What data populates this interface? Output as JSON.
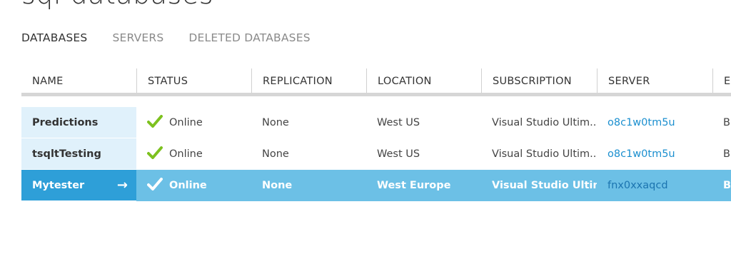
{
  "page": {
    "title": "sql databases"
  },
  "tabs": [
    {
      "label": "DATABASES"
    },
    {
      "label": "SERVERS"
    },
    {
      "label": "DELETED DATABASES"
    }
  ],
  "columns": [
    "NAME",
    "STATUS",
    "REPLICATION",
    "LOCATION",
    "SUBSCRIPTION",
    "SERVER",
    "EDITION"
  ],
  "rows": [
    {
      "name": "Predictions",
      "status": "Online",
      "replication": "None",
      "location": "West US",
      "subscription": "Visual Studio Ultim...",
      "server": "o8c1w0tm5u",
      "edition": "Basic"
    },
    {
      "name": "tsqltTesting",
      "status": "Online",
      "replication": "None",
      "location": "West US",
      "subscription": "Visual Studio Ultim...",
      "server": "o8c1w0tm5u",
      "edition": "Basic"
    },
    {
      "name": "Mytester",
      "status": "Online",
      "replication": "None",
      "location": "West Europe",
      "subscription": "Visual Studio Ultim...",
      "server": "fnx0xxaqcd",
      "edition": "Basic",
      "arrow": "→"
    }
  ],
  "colors": {
    "status_check": "#7dc11f",
    "selected_row": "#6cc0e6",
    "selected_name_cell": "#2e9fd8",
    "name_cell": "#e0f1fb",
    "server_link": "#1b8fcf"
  }
}
